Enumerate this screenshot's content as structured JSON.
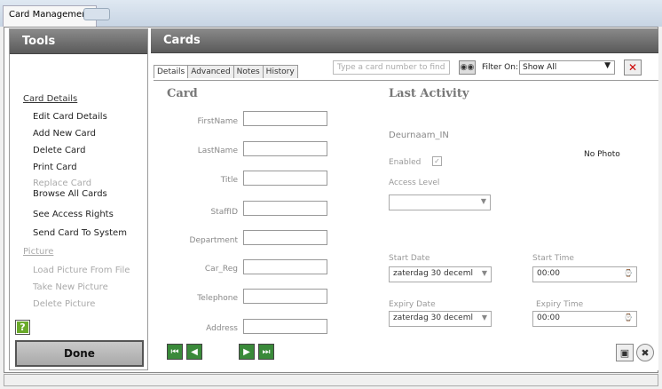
{
  "window": {
    "title": "Card Management"
  },
  "tools": {
    "header": "Tools",
    "done": "Done",
    "help": "?",
    "section1": "Card Details",
    "items1": [
      "Edit Card Details",
      "Add New Card",
      "Delete Card",
      "Print Card",
      "Replace Card",
      "Browse All Cards",
      "See Access Rights",
      "Send Card To System"
    ],
    "section2": "Picture",
    "items2": [
      "Load Picture From File",
      "Take New Picture",
      "Delete Picture"
    ]
  },
  "cards": {
    "header": "Cards",
    "tabs": [
      "Details",
      "Advanced",
      "Notes",
      "History"
    ],
    "search_placeholder": "Type a card number to find",
    "filter_label": "Filter On:",
    "filter_value": "Show All",
    "card_heading": "Card",
    "fields": [
      "FirstName",
      "LastName",
      "Title",
      "StaffID",
      "Department",
      "Car_Reg",
      "Telephone",
      "Address"
    ],
    "activity_heading": "Last Activity",
    "reader": "Deurnaam_IN",
    "enabled": "Enabled",
    "enabled_mark": "✓",
    "access_level": "Access Level",
    "no_photo": "No Photo",
    "start_date_label": "Start Date",
    "start_date": "zaterdag  30 deceml",
    "start_time_label": "Start Time",
    "start_time": "00:00",
    "expiry_date_label": "Expiry Date",
    "expiry_date": "zaterdag  30 deceml",
    "expiry_time_label": "Expiry Time",
    "expiry_time": "00:00"
  }
}
